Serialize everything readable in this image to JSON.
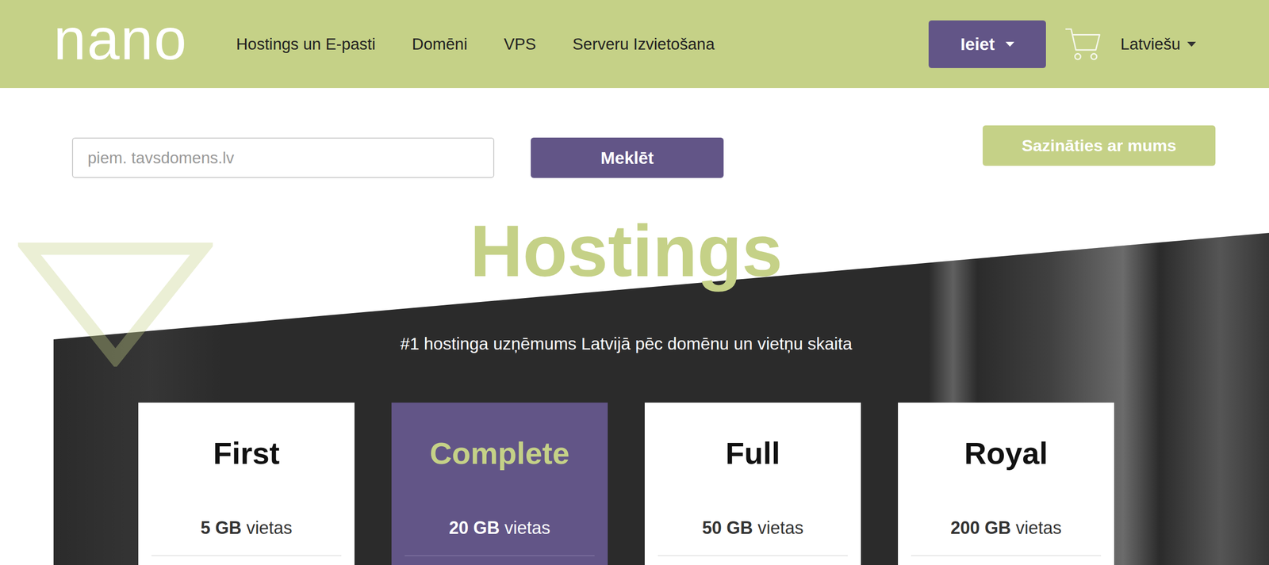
{
  "header": {
    "logo": "nano",
    "nav": [
      "Hostings un E-pasti",
      "Domēni",
      "VPS",
      "Serveru Izvietošana"
    ],
    "login_button": "Ieiet",
    "language": "Latviešu"
  },
  "search": {
    "placeholder": "piem. tavsdomens.lv",
    "button": "Meklēt"
  },
  "contact_button": "Sazināties ar mums",
  "hero": {
    "title": "Hostings",
    "subtitle": "#1 hostinga uzņēmums Latvijā pēc domēnu un vietņu skaita"
  },
  "plans": [
    {
      "name": "First",
      "storage": "5 GB",
      "storage_label": "vietas",
      "selected": false
    },
    {
      "name": "Complete",
      "storage": "20 GB",
      "storage_label": "vietas",
      "selected": true
    },
    {
      "name": "Full",
      "storage": "50 GB",
      "storage_label": "vietas",
      "selected": false
    },
    {
      "name": "Royal",
      "storage": "200 GB",
      "storage_label": "vietas",
      "selected": false
    }
  ]
}
